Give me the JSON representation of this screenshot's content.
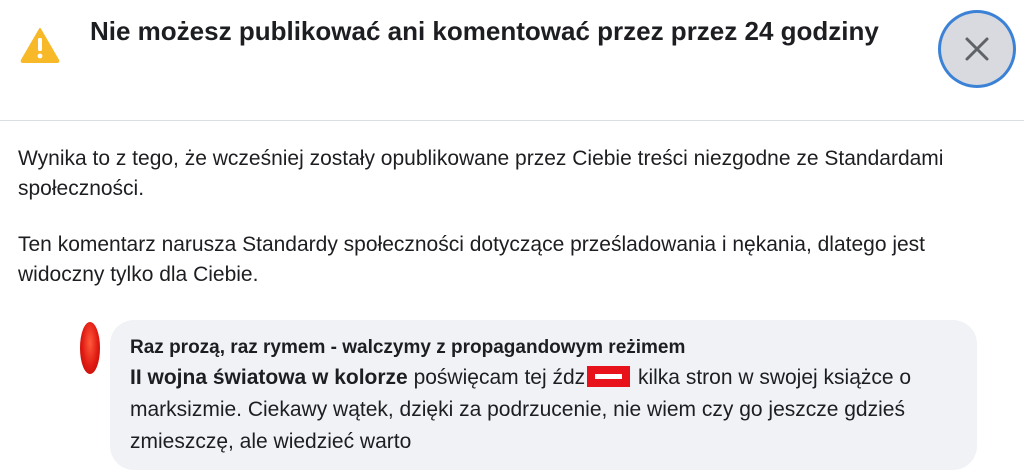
{
  "dialog": {
    "title": "Nie możesz publikować ani komentować przez przez 24 godziny",
    "close_icon": "close-icon",
    "warning_icon": "warning-icon",
    "accent_color": "#3b82d6",
    "warning_color": "#f7b928"
  },
  "body": {
    "paragraph_1": "Wynika to z tego, że wcześniej zostały opublikowane przez Ciebie treści niezgodne ze Standardami społeczności.",
    "paragraph_2": "Ten komentarz narusza Standardy społeczności dotyczące prześladowania i nękania, dlatego jest widoczny tylko dla Ciebie."
  },
  "comment": {
    "author": "Raz prozą, raz rymem - walczymy z propagandowym reżimem",
    "bold_text": "II wojna światowa w kolorze",
    "text_before_redaction": " poświęcam tej źdz",
    "text_after_redaction": " kilka stron w swojej książce o marksizmie. Ciekawy wątek, dzięki za podrzucenie, nie wiem czy go jeszcze gdzieś zmieszczę, ale wiedzieć warto"
  }
}
